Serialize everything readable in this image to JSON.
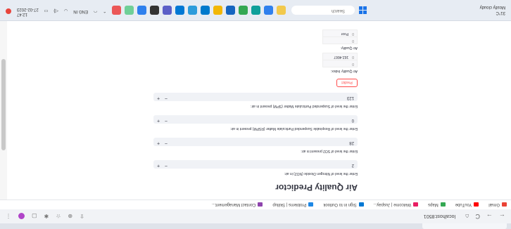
{
  "browser": {
    "address": "localhost:8501",
    "nav": [
      "←",
      "→",
      "C",
      "⌂"
    ]
  },
  "bookmarks": [
    {
      "label": "Gmail",
      "color": "#ea4335"
    },
    {
      "label": "YouTube",
      "color": "#ff0000"
    },
    {
      "label": "Maps",
      "color": "#34a853"
    },
    {
      "label": "Welcome | Juspay...",
      "color": "#e91e63"
    },
    {
      "label": "Sign in to Outlook",
      "color": "#0078d4"
    },
    {
      "label": "Problems | Skillup",
      "color": "#1e88e5"
    },
    {
      "label": "Contact Management...",
      "color": "#8e44ad"
    }
  ],
  "app": {
    "title": "Air Quality Predictor",
    "fields": [
      {
        "label": "Enter the level of Nitrogen Dioxide (NO2) in air:",
        "value": "2"
      },
      {
        "label": "Enter the level of SO2 present in air:",
        "value": "28"
      },
      {
        "label": "Enter the level of Respirable Suspended Particulate Matter (RSPM) present in air:",
        "value": "0"
      },
      {
        "label": "Enter the level of Suspended Particulate Matter (SPM) present in air:",
        "value": "123"
      }
    ],
    "predict_label": "Predict",
    "quality_index_label": "Air Quality Index:",
    "quality_index_rows": [
      {
        "idx": "0",
        "value": ""
      },
      {
        "idx": "0",
        "value": "162.4667"
      }
    ],
    "quality_label": "Air Quality:",
    "quality_rows": [
      {
        "idx": "0",
        "value": ""
      },
      {
        "idx": "0",
        "value": "Poor"
      }
    ]
  },
  "taskbar": {
    "weather_temp": "31°C",
    "weather_desc": "Mostly cloudy",
    "search_placeholder": "Search",
    "lang": "ENG",
    "lang_sub": "IN",
    "time": "12:47",
    "date": "27-02-2023"
  },
  "colors": {
    "accent": "#ff4b4b",
    "input_bg": "#f0f2f6"
  }
}
